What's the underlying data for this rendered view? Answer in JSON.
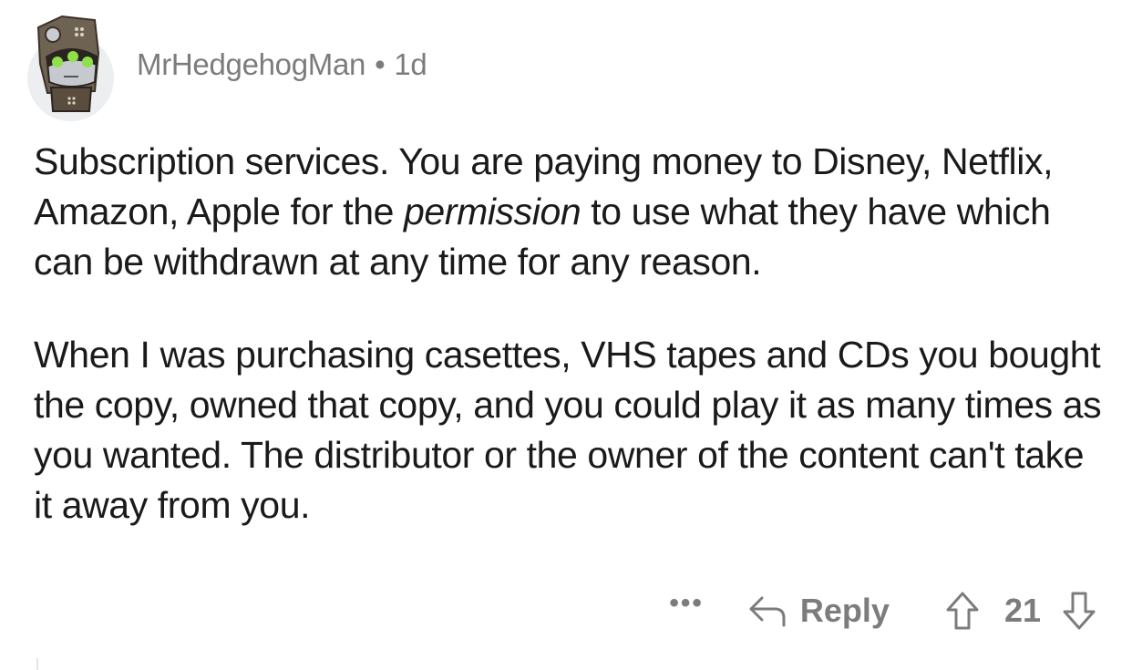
{
  "comment": {
    "author": "MrHedgehogMan",
    "separator": "•",
    "age": "1d",
    "avatar_icon": "robot-avatar",
    "paragraph1": {
      "before": "Subscription services. You are paying money to Disney, Netflix, Amazon, Apple for the ",
      "italic": "permission",
      "after": " to use what they have which can be withdrawn at any time for any reason."
    },
    "paragraph2": "When I was purchasing casettes, VHS tapes and CDs you bought the copy, owned that copy, and you could play it as many times as you wanted. The distributor or the owner of the content can't take it away from you.",
    "actions": {
      "more_label": "•••",
      "reply_label": "Reply",
      "score": "21",
      "icons": [
        "more-icon",
        "reply-arrow-icon",
        "upvote-arrow-icon",
        "downvote-arrow-icon"
      ]
    }
  },
  "colors": {
    "meta_text": "#7c7c7c",
    "body_text": "#1a1a1b",
    "avatar_bg": "#eceef0"
  }
}
